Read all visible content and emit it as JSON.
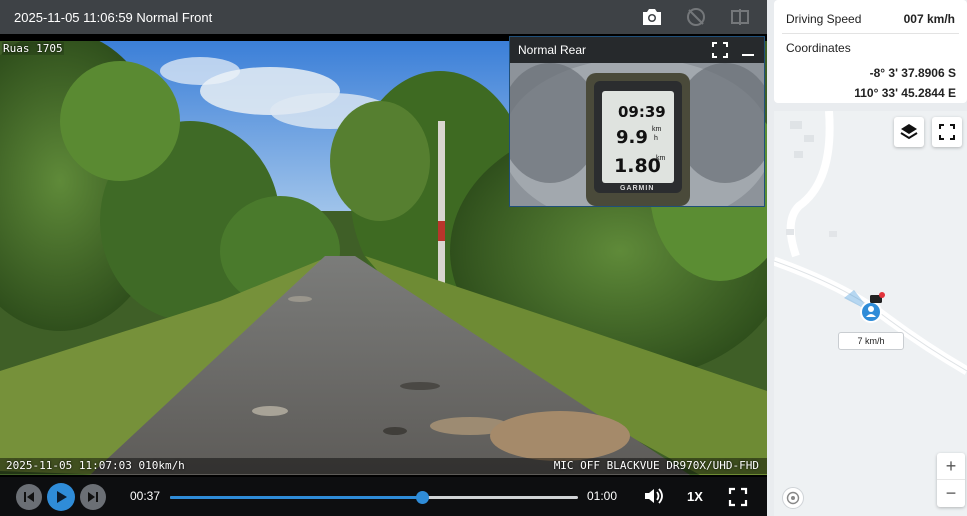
{
  "player": {
    "title": "2025-11-05 11:06:59 Normal Front",
    "front_label": "Ruas 1705",
    "osd_left": "2025-11-05 11:07:03 010km/h",
    "osd_right": "MIC OFF BLACKVUE DR970X/UHD-FHD",
    "pip_title": "Normal Rear",
    "time_current": "00:37",
    "time_total": "01:00",
    "progress": 0.617,
    "speed_rate": "1X",
    "icons": [
      "camera-icon",
      "rotate-icon",
      "flip-icon",
      "fullscreen-icon",
      "minimize-icon",
      "prev-icon",
      "play-icon",
      "next-icon",
      "volume-icon"
    ]
  },
  "rear_gauge": {
    "time": "09:39",
    "speed": "9.9",
    "distance": "1.80",
    "unit_top": "km",
    "unit_bottom": "h",
    "brand": "GARMIN"
  },
  "info": {
    "speed_label": "Driving Speed",
    "speed_value": "007 km/h",
    "coords_label": "Coordinates",
    "latitude": "-8° 3' 37.8906 S",
    "longitude": "110° 33' 45.2844 E"
  },
  "map": {
    "speed_tag": "7 km/h",
    "zoom_in": "+",
    "zoom_out": "−",
    "accent": "#2f8cd8",
    "icons": [
      "layers-icon",
      "fullscreen-icon",
      "vehicle-marker-icon",
      "compass-icon"
    ]
  }
}
